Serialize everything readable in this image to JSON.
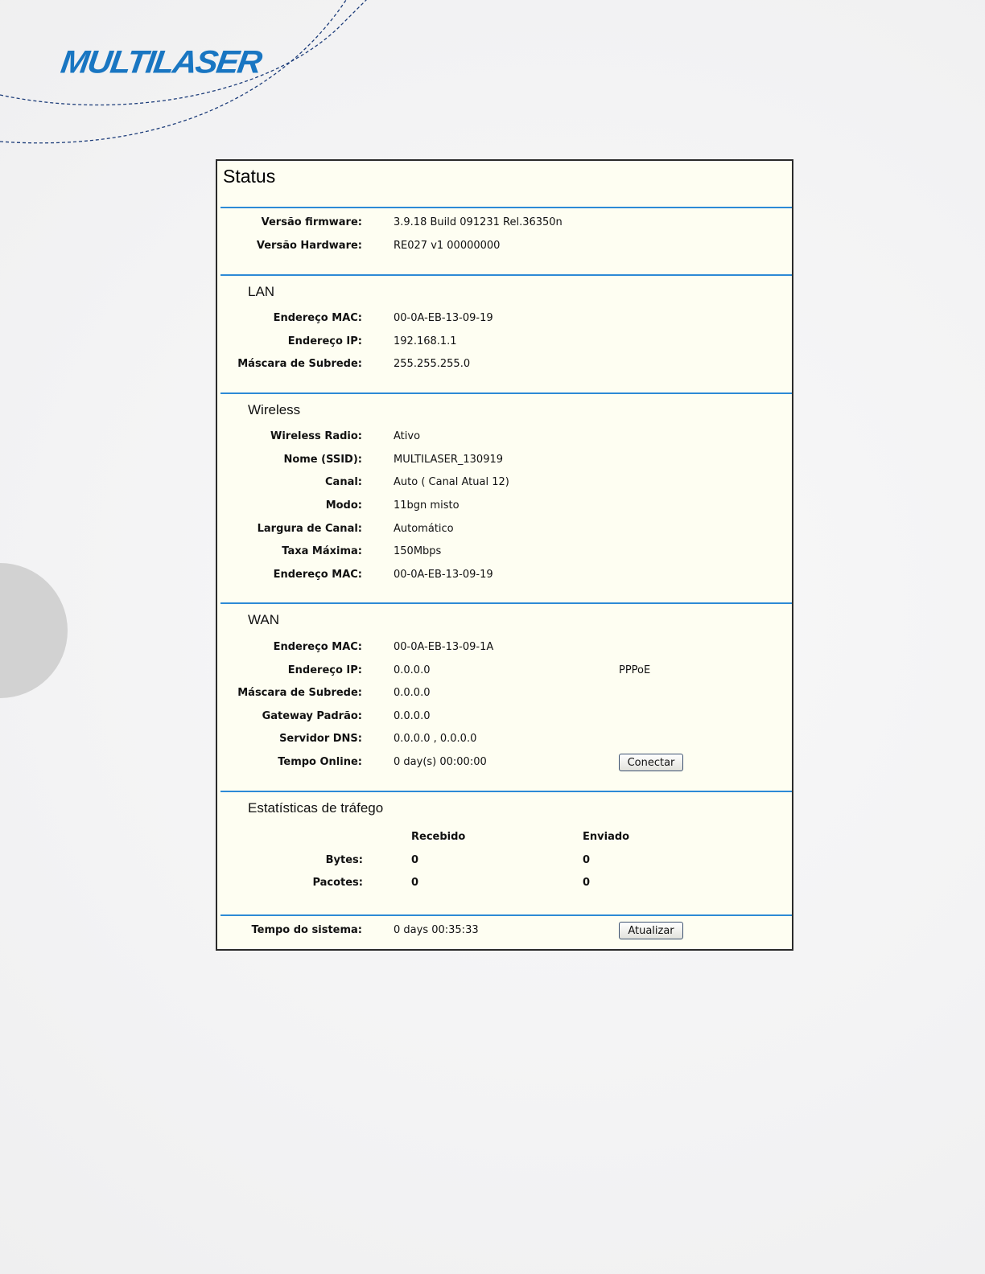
{
  "brand": {
    "logo_text": "MULTILASER",
    "color": "#1976c2"
  },
  "panel": {
    "title": "Status",
    "firmware": {
      "label": "Versão firmware:",
      "value": "3.9.18 Build 091231 Rel.36350n"
    },
    "hardware": {
      "label": "Versão Hardware:",
      "value": "RE027 v1 00000000"
    }
  },
  "lan": {
    "title": "LAN",
    "mac": {
      "label": "Endereço MAC:",
      "value": "00-0A-EB-13-09-19"
    },
    "ip": {
      "label": "Endereço IP:",
      "value": "192.168.1.1"
    },
    "mask": {
      "label": "Máscara de Subrede:",
      "value": "255.255.255.0"
    }
  },
  "wireless": {
    "title": "Wireless",
    "radio": {
      "label": "Wireless Radio:",
      "value": "Ativo"
    },
    "ssid": {
      "label": "Nome (SSID):",
      "value": "MULTILASER_130919"
    },
    "channel": {
      "label": "Canal:",
      "value": "Auto ( Canal Atual 12)"
    },
    "mode": {
      "label": "Modo:",
      "value": "11bgn misto"
    },
    "width": {
      "label": "Largura de Canal:",
      "value": "Automático"
    },
    "rate": {
      "label": "Taxa Máxima:",
      "value": "150Mbps"
    },
    "mac": {
      "label": "Endereço MAC:",
      "value": "00-0A-EB-13-09-19"
    }
  },
  "wan": {
    "title": "WAN",
    "mac": {
      "label": "Endereço MAC:",
      "value": "00-0A-EB-13-09-1A"
    },
    "ip": {
      "label": "Endereço IP:",
      "value": "0.0.0.0",
      "type": "PPPoE"
    },
    "mask": {
      "label": "Máscara de Subrede:",
      "value": "0.0.0.0"
    },
    "gateway": {
      "label": "Gateway Padrão:",
      "value": "0.0.0.0"
    },
    "dns": {
      "label": "Servidor DNS:",
      "value": "0.0.0.0 , 0.0.0.0"
    },
    "online": {
      "label": "Tempo Online:",
      "value": "0 day(s) 00:00:00"
    },
    "connect_label": "Conectar"
  },
  "traffic": {
    "title": "Estatísticas de tráfego",
    "received_header": "Recebido",
    "sent_header": "Enviado",
    "bytes": {
      "label": "Bytes:",
      "received": "0",
      "sent": "0"
    },
    "packets": {
      "label": "Pacotes:",
      "received": "0",
      "sent": "0"
    }
  },
  "system": {
    "label": "Tempo do sistema:",
    "value": "0 days 00:35:33",
    "refresh_label": "Atualizar"
  },
  "colors": {
    "separator": "#2d8ad6",
    "panel_bg": "#fefef2"
  }
}
